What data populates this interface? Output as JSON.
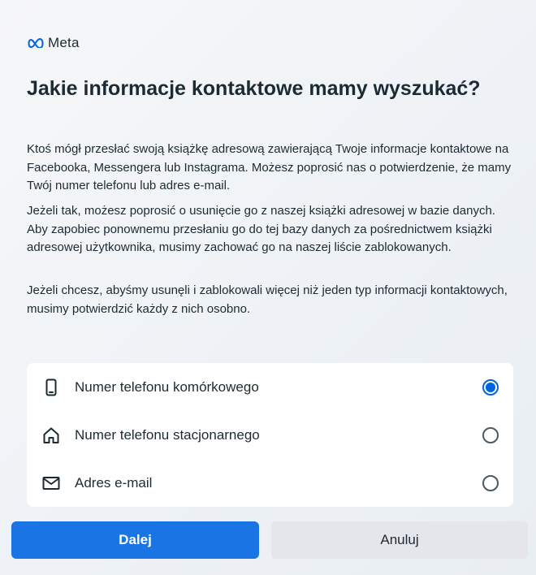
{
  "brand": {
    "logo_text": "Meta"
  },
  "title": "Jakie informacje kontaktowe mamy wyszukać?",
  "paragraphs": [
    "Ktoś mógł przesłać swoją książkę adresową zawierającą Twoje informacje kontaktowe na Facebooka, Messengera lub Instagrama. Możesz poprosić nas o potwierdzenie, że mamy Twój numer telefonu lub adres e-mail.",
    "Jeżeli tak, możesz poprosić o usunięcie go z naszej książki adresowej w bazie danych. Aby zapobiec ponownemu przesłaniu go do tej bazy danych za pośrednictwem książki adresowej użytkownika, musimy zachować go na naszej liście zablokowanych.",
    "Jeżeli chcesz, abyśmy usunęli i zablokowali więcej niż jeden typ informacji kontaktowych, musimy potwierdzić każdy z nich osobno."
  ],
  "options": [
    {
      "label": "Numer telefonu komórkowego",
      "icon": "mobile-phone-icon",
      "selected": true
    },
    {
      "label": "Numer telefonu stacjonarnego",
      "icon": "home-icon",
      "selected": false
    },
    {
      "label": "Adres e-mail",
      "icon": "envelope-icon",
      "selected": false
    }
  ],
  "buttons": {
    "next": "Dalej",
    "cancel": "Anuluj"
  },
  "colors": {
    "accent": "#1b74e4",
    "radio_selected": "#0064e0",
    "text": "#1c2b33"
  }
}
